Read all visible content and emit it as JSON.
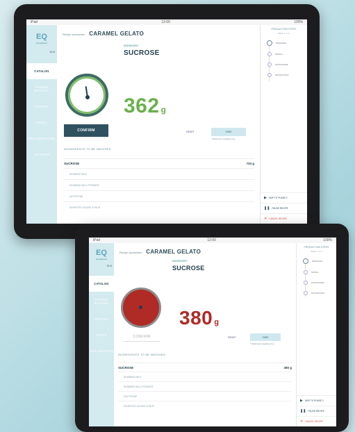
{
  "top": {
    "statusbar": {
      "left": "iPad",
      "center": "12:00",
      "right": "100%"
    },
    "logo": {
      "mark": "EQ",
      "subtitle": "EasyQuant"
    },
    "user_badge": "SLB",
    "nav": [
      "CATALOG",
      "PAUSED BATCHES",
      "HISTORY",
      "TOOLS",
      "DOCUMENTATION",
      "SETTINGS"
    ],
    "nav_active_index": 0,
    "breadcrumb": {
      "crumb": "Recipe production",
      "recipe": "CARAMEL GELATO"
    },
    "ingredient_label": "INGREDIENT",
    "ingredient_name": "SUCROSE",
    "weight": {
      "value": "362",
      "unit": "g"
    },
    "confirm_label": "CONFIRM",
    "tare_label": "RESET",
    "tare_btn": "TARE",
    "note": "* Reference weighing: 0 g",
    "section_title": "INGREDIENTS TO BE WEIGHED",
    "rows": [
      {
        "label": "SUCROSE",
        "value": "734 g"
      },
      {
        "label": "SKIMMED MILK",
        "value": ""
      },
      {
        "label": "SKIMMED MILK POWDER",
        "value": ""
      },
      {
        "label": "DEXTROSE",
        "value": ""
      },
      {
        "label": "INVERTED SUGAR SYRUP",
        "value": ""
      }
    ],
    "right_panel": {
      "title": "PRODUCTION STEPS",
      "subtitle": "Batch 1 of 3",
      "steps": [
        "WEIGHING",
        "MIXING",
        "PASTEURIZE",
        "MATURATION"
      ],
      "actions": [
        {
          "icon": "skip-icon",
          "label": "SKIP TO PHASE 2"
        },
        {
          "icon": "pause-icon",
          "label": "PAUSE RECIPE"
        },
        {
          "icon": "cancel-icon",
          "label": "CANCEL RECIPE"
        }
      ]
    },
    "colors": {
      "accent": "#6ab04c",
      "sidebar": "#d3eaef",
      "dark": "#2f5160"
    }
  },
  "bottom": {
    "statusbar": {
      "left": "iPad",
      "center": "12:00",
      "right": "100%"
    },
    "logo": {
      "mark": "EQ",
      "subtitle": "EasyQuant"
    },
    "user_badge": "SLB",
    "nav": [
      "CATALOG",
      "PAUSED BATCHES",
      "HISTORY",
      "TOOLS",
      "DOCUMENTATION"
    ],
    "nav_active_index": 0,
    "breadcrumb": {
      "crumb": "Recipe production",
      "recipe": "CARAMEL GELATO"
    },
    "ingredient_label": "INGREDIENT",
    "ingredient_name": "SUCROSE",
    "weight": {
      "value": "380",
      "unit": "g"
    },
    "confirm_label": "CONFIRM",
    "tare_label": "RESET",
    "tare_btn": "TARE",
    "note": "* Reference weighing: 0 g",
    "section_title": "INGREDIENTS TO BE WEIGHED",
    "rows": [
      {
        "label": "SUCROSE",
        "value": "380 g"
      },
      {
        "label": "SKIMMED MILK",
        "value": ""
      },
      {
        "label": "SKIMMED MILK POWDER",
        "value": ""
      },
      {
        "label": "DEXTROSE",
        "value": ""
      },
      {
        "label": "INVERTED SUGAR SYRUP",
        "value": ""
      }
    ],
    "right_panel": {
      "title": "PRODUCTION STEPS",
      "subtitle": "Batch 1 of 3",
      "steps": [
        "WEIGHING",
        "MIXING",
        "PASTEURIZE",
        "MATURATION"
      ],
      "actions": [
        {
          "icon": "skip-icon",
          "label": "SKIP TO PHASE 2"
        },
        {
          "icon": "pause-icon",
          "label": "PAUSE RECIPE"
        },
        {
          "icon": "cancel-icon",
          "label": "CANCEL RECIPE"
        }
      ]
    },
    "colors": {
      "accent": "#b02a26",
      "sidebar": "#d3eaef"
    }
  }
}
